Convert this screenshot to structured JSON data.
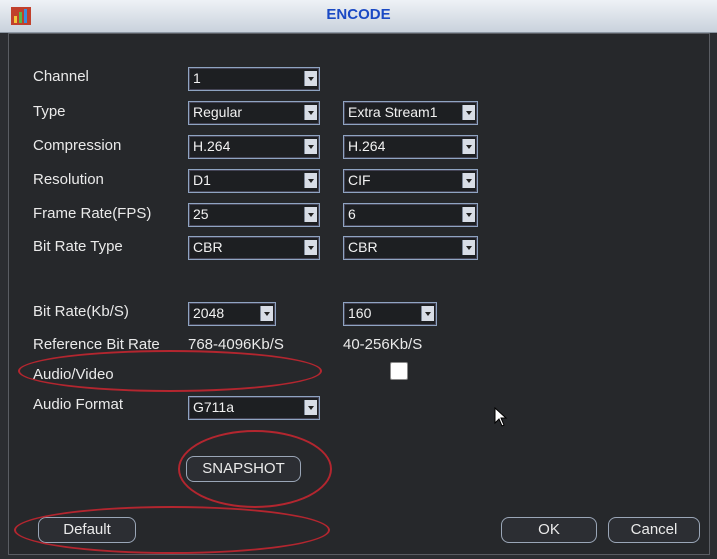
{
  "window": {
    "title": "ENCODE"
  },
  "form": {
    "channel": {
      "label": "Channel",
      "value": "1"
    },
    "type": {
      "label": "Type",
      "main": "Regular",
      "extra": "Extra Stream1"
    },
    "compression": {
      "label": "Compression",
      "main": "H.264",
      "extra": "H.264"
    },
    "resolution": {
      "label": "Resolution",
      "main": "D1",
      "extra": "CIF"
    },
    "frame_rate": {
      "label": "Frame Rate(FPS)",
      "main": "25",
      "extra": "6"
    },
    "bit_rate_type": {
      "label": "Bit Rate Type",
      "main": "CBR",
      "extra": "CBR"
    },
    "bit_rate": {
      "label": "Bit Rate(Kb/S)",
      "main": "2048",
      "extra": "160"
    },
    "reference_bit_rate": {
      "label": "Reference Bit Rate",
      "main": "768-4096Kb/S",
      "extra": "40-256Kb/S"
    },
    "audio_video": {
      "label": "Audio/Video",
      "checked": false
    },
    "audio_format": {
      "label": "Audio Format",
      "value": "G711a"
    }
  },
  "buttons": {
    "snapshot": "SNAPSHOT",
    "default": "Default",
    "ok": "OK",
    "cancel": "Cancel"
  },
  "colors": {
    "panel": "#26282b",
    "title_text": "#1a49c4",
    "highlight_oval": "#b3262f"
  }
}
